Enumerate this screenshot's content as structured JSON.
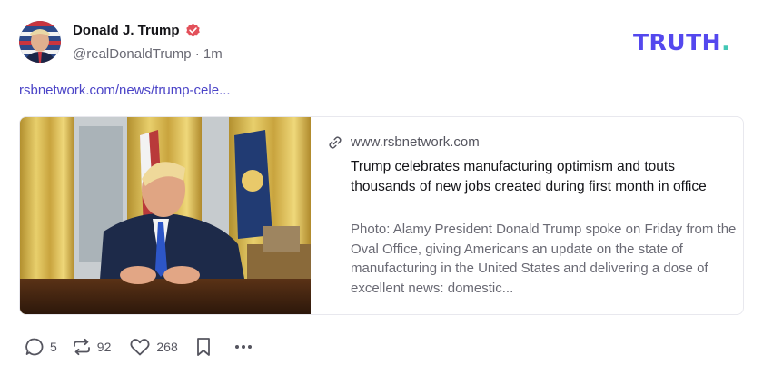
{
  "author": {
    "name": "Donald J. Trump",
    "handle": "@realDonaldTrump",
    "separator": "·",
    "time": "1m",
    "verified": true,
    "avatar_icon": "avatar-portrait-flag"
  },
  "brand": {
    "text": "TRUTH",
    "dot": ".",
    "color": "#5448ee",
    "dot_color": "#43c7b5"
  },
  "post": {
    "link_text": "rsbnetwork.com/news/trump-cele..."
  },
  "card": {
    "image_alt": "President Donald Trump speaking in the Oval Office",
    "domain": "www.rsbnetwork.com",
    "domain_icon": "link-icon",
    "title": "Trump celebrates manufacturing optimism and touts thousands of new jobs created during first month in office",
    "description": "Photo: Alamy President Donald Trump spoke on Friday from the Oval Office, giving Americans an update on the state of manufacturing in the United States and delivering a dose of excellent news: domestic..."
  },
  "actions": {
    "replies": "5",
    "retruths": "92",
    "likes": "268",
    "reply_icon": "reply-icon",
    "retruth_icon": "retruth-icon",
    "like_icon": "heart-icon",
    "bookmark_icon": "bookmark-icon",
    "more_icon": "more-icon"
  },
  "colors": {
    "link": "#4b44c7",
    "muted": "#6a6a74",
    "text": "#141418",
    "verified": "#e3505a"
  }
}
